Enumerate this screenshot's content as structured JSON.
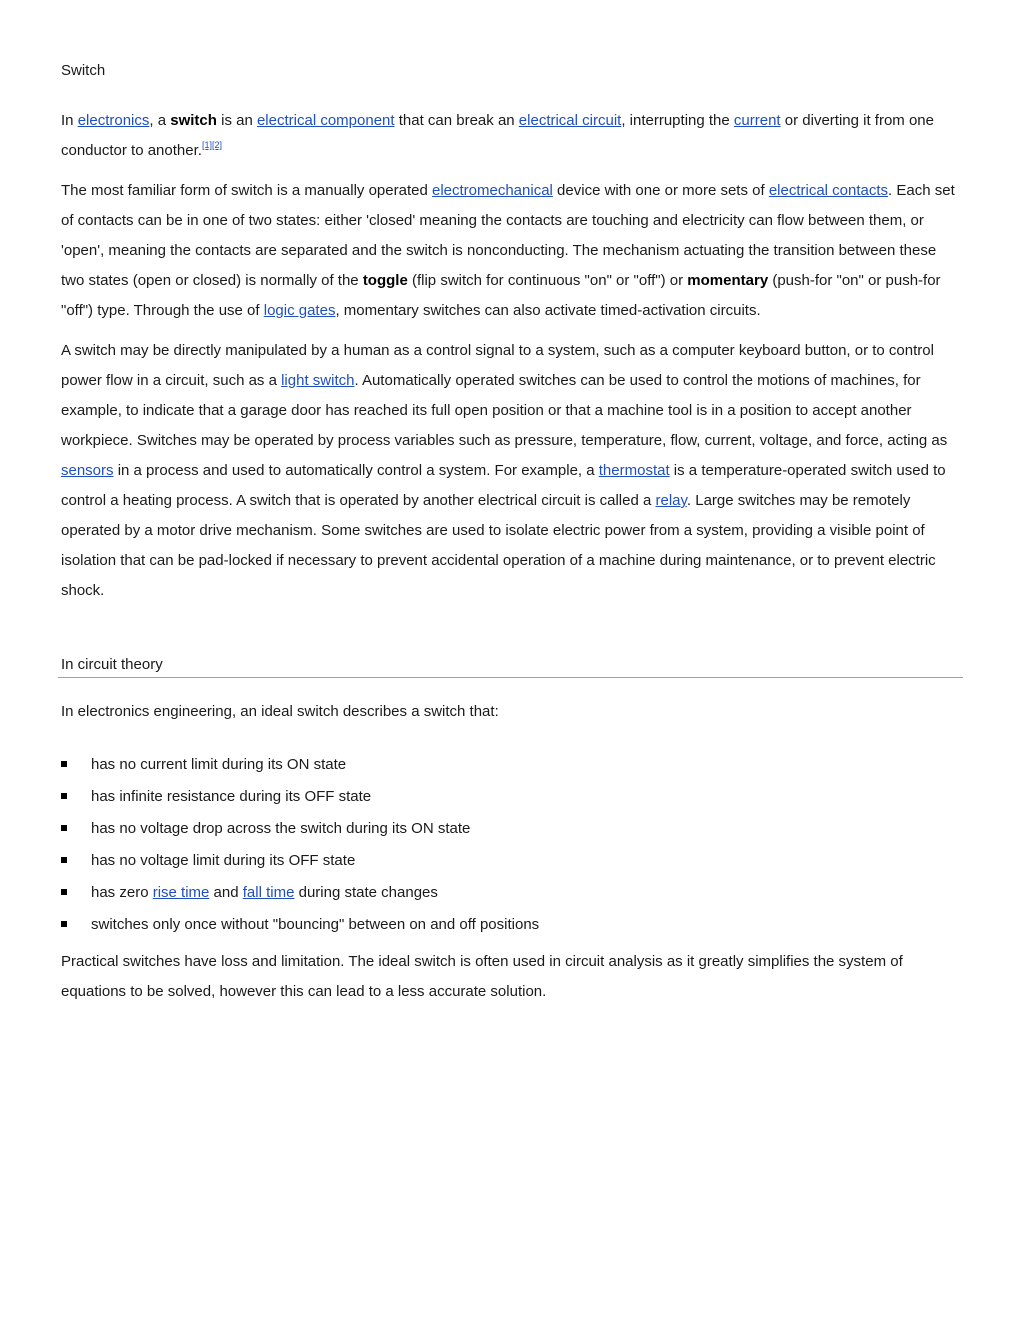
{
  "title": "Switch",
  "p1": {
    "t1": "In ",
    "l1": "electronics",
    "t2": ", a ",
    "b1": "switch",
    "t3": " is an ",
    "l2": "electrical component",
    "t4": " that can break an ",
    "l3": "electrical circuit",
    "t5": ", interrupting the ",
    "l4": "current",
    "t6": " or diverting it from one conductor to another.",
    "ref1": "[1]",
    "ref2": "[2]"
  },
  "p2": {
    "t1": "The most familiar form of switch is a manually operated ",
    "l1": "electromechanical",
    "t2": " device with one or more sets of ",
    "l2": "electrical contacts",
    "t3": ". Each set of contacts can be in one of two states: either 'closed' meaning the contacts are touching and electricity can flow between them, or 'open', meaning the contacts are separated and the switch is nonconducting. The mechanism actuating the transition between these two states (open or closed) is normally of the ",
    "b1": "toggle",
    "t4": " (flip switch for continuous \"on\" or \"off\") or ",
    "b2": "momentary",
    "t5": " (push-for \"on\" or push-for \"off\") type. Through the use of ",
    "l3": "logic gates",
    "t6": ", momentary switches can also activate timed-activation circuits."
  },
  "p3": {
    "t1": "A switch may be directly manipulated by a human as a control signal to a system, such as a computer keyboard button, or to control power flow in a circuit, such as a ",
    "l1": "light switch",
    "t2": ". Automatically operated switches can be used to control the motions of machines, for example, to indicate that a garage door has reached its full open position or that a machine tool is in a position to accept another workpiece. Switches may be operated by process variables such as pressure, temperature, flow, current, voltage, and force, acting as ",
    "l2": "sensors",
    "t3": " in a process and used to automatically control a system. For example, a ",
    "l3": "thermostat",
    "t4": " is a temperature-operated switch used to control a heating process. A switch that is operated by another electrical circuit is called a ",
    "l4": "relay",
    "t5": ". Large switches may be remotely operated by a motor drive mechanism. Some switches are used to isolate electric power from a system, providing a visible point of isolation that can be pad-locked if necessary to prevent accidental operation of a machine during maintenance, or to prevent electric shock."
  },
  "section2": {
    "heading": "In circuit theory",
    "intro": "In electronics engineering, an ideal switch describes a switch that:",
    "bullets": [
      {
        "text": "has no current limit during its ON state"
      },
      {
        "text": "has infinite resistance during its OFF state"
      },
      {
        "text": "has no voltage drop across the switch during its ON state"
      },
      {
        "text": "has no voltage limit during its OFF state"
      },
      {
        "pre": "has zero ",
        "l1": "rise time",
        "mid": " and ",
        "l2": "fall time",
        "post": " during state changes"
      },
      {
        "text": "switches only once without \"bouncing\" between on and off positions"
      }
    ],
    "closing": "Practical switches have loss and limitation. The ideal switch is often used in circuit analysis as it greatly simplifies the system of equations to be solved, however this can lead to a less accurate solution."
  }
}
